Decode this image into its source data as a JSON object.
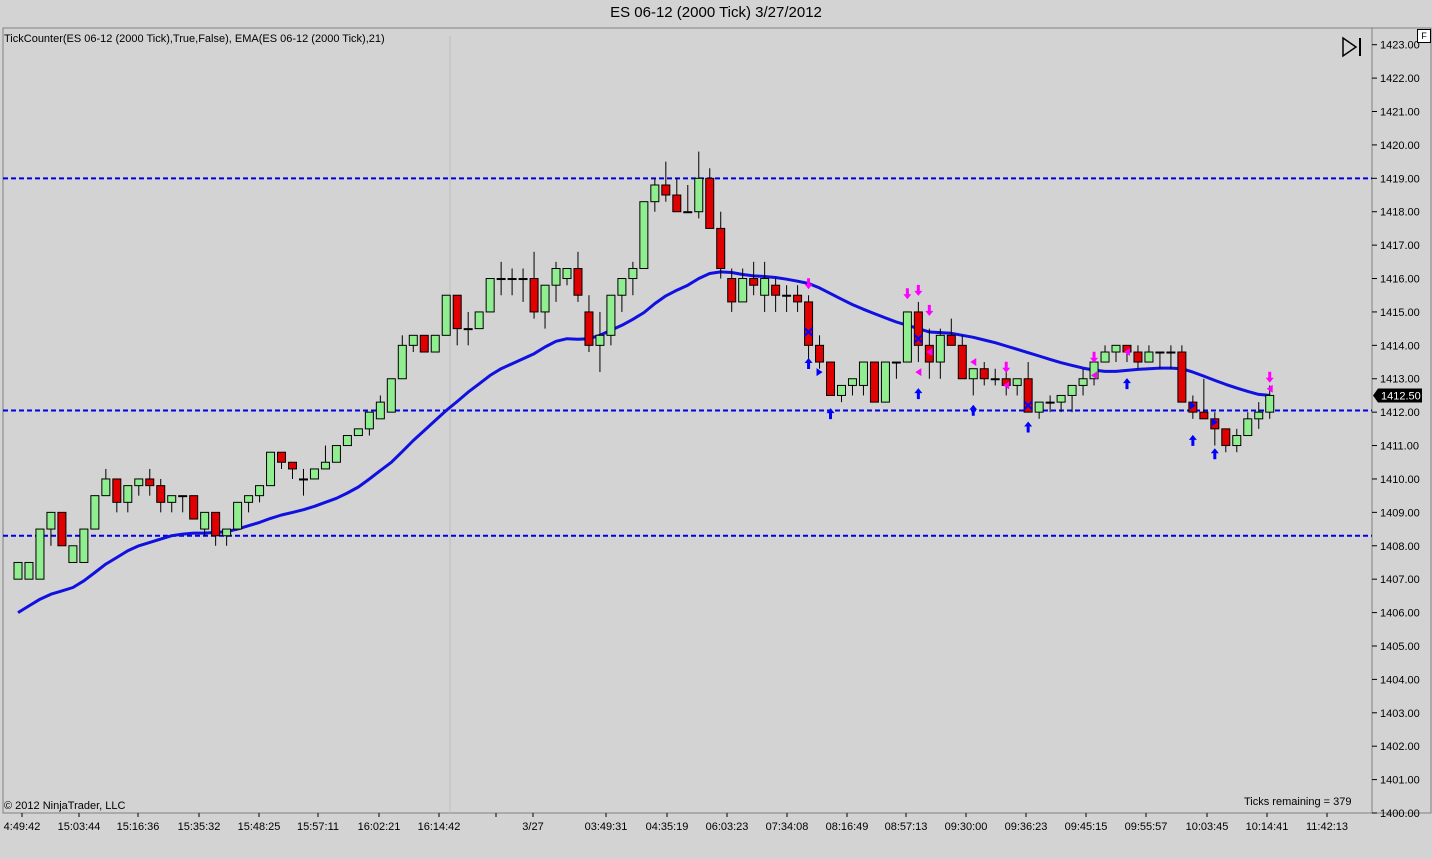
{
  "window": {
    "title": "ES 06-12 (2000 Tick)  3/27/2012"
  },
  "indicator_label": "TickCounter(ES 06-12 (2000 Tick),True,False), EMA(ES 06-12 (2000 Tick),21)",
  "copyright": "© 2012 NinjaTrader, LLC",
  "ticks_remaining": "Ticks remaining = 379",
  "panel_button": "F",
  "price_tag": "1412.50",
  "colors": {
    "up": "#90ee90",
    "down": "#e00000",
    "ema": "#1010e0",
    "hline": "#0000e0",
    "marker_buy": "#0000ff",
    "marker_sell": "#ff00ff"
  },
  "chart_data": {
    "type": "candlestick",
    "ylim": [
      1400,
      1423.5
    ],
    "y_ticks": [
      1400,
      1401,
      1402,
      1403,
      1404,
      1405,
      1406,
      1407,
      1408,
      1409,
      1410,
      1411,
      1412,
      1413,
      1414,
      1415,
      1416,
      1417,
      1418,
      1419,
      1420,
      1421,
      1422,
      1423
    ],
    "x_ticks": [
      "4:49:42",
      "15:03:44",
      "15:16:36",
      "15:35:32",
      "15:48:25",
      "15:57:11",
      "16:02:21",
      "16:14:42",
      "3/27",
      "03:49:31",
      "04:35:19",
      "06:03:23",
      "07:34:08",
      "08:16:49",
      "08:57:13",
      "09:30:00",
      "09:36:23",
      "09:45:15",
      "09:55:57",
      "10:03:45",
      "10:14:41",
      "11:42:13"
    ],
    "horizontal_lines": [
      1419.0,
      1412.05,
      1408.3
    ],
    "candles": [
      [
        1407.0,
        1407.5,
        1407.0,
        1407.5
      ],
      [
        1407.0,
        1407.5,
        1407.0,
        1407.5
      ],
      [
        1407.0,
        1408.5,
        1407.0,
        1408.5
      ],
      [
        1408.5,
        1409.0,
        1408.0,
        1409.0
      ],
      [
        1409.0,
        1409.0,
        1408.0,
        1408.0
      ],
      [
        1407.5,
        1408.0,
        1407.5,
        1408.0
      ],
      [
        1407.5,
        1408.5,
        1407.5,
        1408.5
      ],
      [
        1408.5,
        1409.5,
        1408.5,
        1409.5
      ],
      [
        1409.5,
        1410.3,
        1409.5,
        1410.0
      ],
      [
        1410.0,
        1410.0,
        1409.0,
        1409.3
      ],
      [
        1409.3,
        1409.8,
        1409.0,
        1409.8
      ],
      [
        1409.8,
        1410.0,
        1409.5,
        1410.0
      ],
      [
        1410.0,
        1410.3,
        1409.5,
        1409.8
      ],
      [
        1409.8,
        1410.0,
        1409.0,
        1409.3
      ],
      [
        1409.3,
        1409.5,
        1409.0,
        1409.5
      ],
      [
        1409.5,
        1409.5,
        1409.0,
        1409.5
      ],
      [
        1409.5,
        1409.5,
        1408.8,
        1408.8
      ],
      [
        1408.5,
        1409.0,
        1408.3,
        1409.0
      ],
      [
        1409.0,
        1409.0,
        1408.0,
        1408.3
      ],
      [
        1408.3,
        1408.5,
        1408.0,
        1408.5
      ],
      [
        1408.5,
        1409.3,
        1408.5,
        1409.3
      ],
      [
        1409.3,
        1409.5,
        1409.0,
        1409.5
      ],
      [
        1409.5,
        1409.8,
        1409.3,
        1409.8
      ],
      [
        1409.8,
        1410.8,
        1409.8,
        1410.8
      ],
      [
        1410.8,
        1410.8,
        1410.3,
        1410.5
      ],
      [
        1410.5,
        1410.5,
        1410.0,
        1410.3
      ],
      [
        1410.0,
        1410.3,
        1409.5,
        1410.0
      ],
      [
        1410.0,
        1410.3,
        1410.0,
        1410.3
      ],
      [
        1410.3,
        1411.0,
        1410.3,
        1410.5
      ],
      [
        1410.5,
        1411.0,
        1410.5,
        1411.0
      ],
      [
        1411.0,
        1411.3,
        1411.0,
        1411.3
      ],
      [
        1411.3,
        1411.5,
        1411.3,
        1411.5
      ],
      [
        1411.5,
        1412.0,
        1411.3,
        1412.0
      ],
      [
        1411.8,
        1412.5,
        1411.8,
        1412.3
      ],
      [
        1412.0,
        1413.0,
        1412.0,
        1413.0
      ],
      [
        1413.0,
        1414.3,
        1413.0,
        1414.0
      ],
      [
        1414.0,
        1414.3,
        1413.8,
        1414.3
      ],
      [
        1414.3,
        1414.3,
        1413.8,
        1413.8
      ],
      [
        1413.8,
        1414.3,
        1413.8,
        1414.3
      ],
      [
        1414.3,
        1415.5,
        1414.3,
        1415.5
      ],
      [
        1415.5,
        1415.5,
        1414.0,
        1414.5
      ],
      [
        1414.5,
        1415.0,
        1414.0,
        1414.5
      ],
      [
        1414.5,
        1415.0,
        1414.5,
        1415.0
      ],
      [
        1415.0,
        1416.0,
        1415.0,
        1416.0
      ],
      [
        1416.0,
        1416.5,
        1415.5,
        1416.0
      ],
      [
        1416.0,
        1416.3,
        1415.5,
        1416.0
      ],
      [
        1416.0,
        1416.3,
        1415.3,
        1416.0
      ],
      [
        1416.0,
        1416.8,
        1414.8,
        1415.0
      ],
      [
        1415.0,
        1415.8,
        1414.5,
        1415.8
      ],
      [
        1415.8,
        1416.5,
        1415.3,
        1416.3
      ],
      [
        1416.0,
        1416.3,
        1415.8,
        1416.3
      ],
      [
        1416.3,
        1416.8,
        1415.3,
        1415.5
      ],
      [
        1415.0,
        1415.5,
        1413.8,
        1414.0
      ],
      [
        1414.0,
        1415.0,
        1413.2,
        1414.3
      ],
      [
        1414.3,
        1415.5,
        1414.0,
        1415.5
      ],
      [
        1415.5,
        1416.0,
        1415.0,
        1416.0
      ],
      [
        1416.0,
        1416.5,
        1415.5,
        1416.3
      ],
      [
        1416.3,
        1418.3,
        1416.3,
        1418.3
      ],
      [
        1418.3,
        1419.0,
        1418.0,
        1418.8
      ],
      [
        1418.8,
        1419.5,
        1418.3,
        1418.5
      ],
      [
        1418.5,
        1419.0,
        1418.0,
        1418.0
      ],
      [
        1418.0,
        1418.8,
        1418.0,
        1418.0
      ],
      [
        1418.0,
        1419.8,
        1417.8,
        1419.0
      ],
      [
        1419.0,
        1419.3,
        1417.5,
        1417.5
      ],
      [
        1417.5,
        1418.0,
        1416.0,
        1416.3
      ],
      [
        1416.0,
        1416.3,
        1415.0,
        1415.3
      ],
      [
        1415.3,
        1416.3,
        1415.3,
        1416.0
      ],
      [
        1416.0,
        1416.5,
        1415.5,
        1415.8
      ],
      [
        1415.5,
        1416.5,
        1415.0,
        1416.0
      ],
      [
        1415.8,
        1416.0,
        1415.0,
        1415.5
      ],
      [
        1415.5,
        1415.8,
        1415.0,
        1415.5
      ],
      [
        1415.5,
        1415.8,
        1415.0,
        1415.3
      ],
      [
        1415.3,
        1415.5,
        1413.5,
        1414.0
      ],
      [
        1414.0,
        1414.3,
        1413.3,
        1413.5
      ],
      [
        1413.5,
        1413.5,
        1412.5,
        1412.5
      ],
      [
        1412.5,
        1412.8,
        1412.3,
        1412.8
      ],
      [
        1412.8,
        1413.0,
        1412.5,
        1413.0
      ],
      [
        1412.8,
        1413.5,
        1412.5,
        1413.5
      ],
      [
        1413.5,
        1413.5,
        1412.3,
        1412.3
      ],
      [
        1412.3,
        1413.5,
        1412.3,
        1413.5
      ],
      [
        1413.5,
        1413.5,
        1413.0,
        1413.5
      ],
      [
        1413.5,
        1415.0,
        1413.5,
        1415.0
      ],
      [
        1415.0,
        1415.3,
        1413.5,
        1414.0
      ],
      [
        1414.0,
        1414.5,
        1413.0,
        1413.5
      ],
      [
        1413.5,
        1414.5,
        1413.0,
        1414.3
      ],
      [
        1414.3,
        1414.8,
        1414.0,
        1414.0
      ],
      [
        1414.0,
        1414.3,
        1413.0,
        1413.0
      ],
      [
        1413.0,
        1413.3,
        1412.5,
        1413.3
      ],
      [
        1413.3,
        1413.5,
        1412.8,
        1413.0
      ],
      [
        1413.0,
        1413.3,
        1412.8,
        1413.0
      ],
      [
        1413.0,
        1413.5,
        1412.5,
        1412.8
      ],
      [
        1412.8,
        1413.0,
        1412.5,
        1413.0
      ],
      [
        1413.0,
        1413.5,
        1412.0,
        1412.0
      ],
      [
        1412.0,
        1412.3,
        1411.8,
        1412.3
      ],
      [
        1412.3,
        1412.5,
        1412.0,
        1412.3
      ],
      [
        1412.3,
        1412.5,
        1412.0,
        1412.5
      ],
      [
        1412.5,
        1412.8,
        1412.0,
        1412.8
      ],
      [
        1412.8,
        1413.3,
        1412.5,
        1413.0
      ],
      [
        1413.0,
        1413.5,
        1412.8,
        1413.5
      ],
      [
        1413.5,
        1414.0,
        1413.5,
        1413.8
      ],
      [
        1413.8,
        1414.0,
        1413.5,
        1414.0
      ],
      [
        1414.0,
        1414.0,
        1413.5,
        1413.8
      ],
      [
        1413.8,
        1414.0,
        1413.3,
        1413.5
      ],
      [
        1413.5,
        1414.0,
        1413.5,
        1413.8
      ],
      [
        1413.8,
        1413.8,
        1413.3,
        1413.8
      ],
      [
        1413.8,
        1414.0,
        1413.3,
        1413.8
      ],
      [
        1413.8,
        1414.0,
        1412.3,
        1412.3
      ],
      [
        1412.3,
        1412.5,
        1411.8,
        1412.0
      ],
      [
        1412.0,
        1413.0,
        1411.8,
        1411.8
      ],
      [
        1411.8,
        1412.0,
        1411.0,
        1411.5
      ],
      [
        1411.5,
        1411.5,
        1410.8,
        1411.0
      ],
      [
        1411.0,
        1411.5,
        1410.8,
        1411.3
      ],
      [
        1411.3,
        1412.0,
        1411.3,
        1411.8
      ],
      [
        1411.8,
        1412.3,
        1411.5,
        1412.0
      ],
      [
        1412.0,
        1412.8,
        1411.8,
        1412.5
      ]
    ],
    "ema_series": {
      "values": [
        1406.0,
        1406.2,
        1406.4,
        1406.55,
        1406.65,
        1406.75,
        1406.95,
        1407.2,
        1407.45,
        1407.65,
        1407.85,
        1408.0,
        1408.1,
        1408.2,
        1408.3,
        1408.35,
        1408.38,
        1408.38,
        1408.4,
        1408.42,
        1408.5,
        1408.6,
        1408.7,
        1408.82,
        1408.92,
        1409.0,
        1409.08,
        1409.18,
        1409.3,
        1409.42,
        1409.58,
        1409.76,
        1410.0,
        1410.25,
        1410.5,
        1410.82,
        1411.15,
        1411.45,
        1411.75,
        1412.05,
        1412.32,
        1412.6,
        1412.85,
        1413.1,
        1413.3,
        1413.45,
        1413.6,
        1413.75,
        1413.95,
        1414.12,
        1414.2,
        1414.18,
        1414.2,
        1414.3,
        1414.45,
        1414.6,
        1414.78,
        1414.98,
        1415.25,
        1415.48,
        1415.65,
        1415.8,
        1416.0,
        1416.15,
        1416.2,
        1416.18,
        1416.12,
        1416.08,
        1416.06,
        1416.03,
        1415.98,
        1415.92,
        1415.85,
        1415.72,
        1415.55,
        1415.38,
        1415.22,
        1415.08,
        1414.95,
        1414.82,
        1414.7,
        1414.6,
        1414.5,
        1414.4,
        1414.38,
        1414.36,
        1414.3,
        1414.24,
        1414.16,
        1414.08,
        1413.98,
        1413.88,
        1413.78,
        1413.68,
        1413.58,
        1413.48,
        1413.4,
        1413.32,
        1413.26,
        1413.22,
        1413.22,
        1413.25,
        1413.28,
        1413.3,
        1413.32,
        1413.32,
        1413.3,
        1413.2,
        1413.08,
        1412.95,
        1412.83,
        1412.72,
        1412.62,
        1412.53,
        1412.5
      ]
    },
    "markers": [
      {
        "bar": 72,
        "price": 1415.8,
        "dir": "down"
      },
      {
        "bar": 72,
        "price": 1413.5,
        "dir": "up"
      },
      {
        "bar": 72,
        "price": 1414.4,
        "dir": "x"
      },
      {
        "bar": 73,
        "price": 1413.2,
        "dir": "right"
      },
      {
        "bar": 74,
        "price": 1412.0,
        "dir": "up"
      },
      {
        "bar": 81,
        "price": 1415.5,
        "dir": "down"
      },
      {
        "bar": 82,
        "price": 1415.6,
        "dir": "down"
      },
      {
        "bar": 82,
        "price": 1412.6,
        "dir": "up"
      },
      {
        "bar": 82,
        "price": 1414.2,
        "dir": "x"
      },
      {
        "bar": 83,
        "price": 1415.0,
        "dir": "down"
      },
      {
        "bar": 82,
        "price": 1413.2,
        "dir": "left"
      },
      {
        "bar": 83,
        "price": 1413.8,
        "dir": "left"
      },
      {
        "bar": 87,
        "price": 1413.5,
        "dir": "left"
      },
      {
        "bar": 87,
        "price": 1412.1,
        "dir": "up"
      },
      {
        "bar": 90,
        "price": 1413.3,
        "dir": "down"
      },
      {
        "bar": 90,
        "price": 1412.8,
        "dir": "left"
      },
      {
        "bar": 92,
        "price": 1411.6,
        "dir": "up"
      },
      {
        "bar": 92,
        "price": 1412.2,
        "dir": "x"
      },
      {
        "bar": 98,
        "price": 1413.6,
        "dir": "down"
      },
      {
        "bar": 98,
        "price": 1413.1,
        "dir": "left"
      },
      {
        "bar": 101,
        "price": 1413.8,
        "dir": "left"
      },
      {
        "bar": 101,
        "price": 1412.9,
        "dir": "up"
      },
      {
        "bar": 107,
        "price": 1412.2,
        "dir": "right"
      },
      {
        "bar": 107,
        "price": 1411.2,
        "dir": "up"
      },
      {
        "bar": 109,
        "price": 1411.7,
        "dir": "right"
      },
      {
        "bar": 109,
        "price": 1410.8,
        "dir": "up"
      },
      {
        "bar": 114,
        "price": 1413.0,
        "dir": "down"
      },
      {
        "bar": 114,
        "price": 1412.7,
        "dir": "left"
      }
    ]
  }
}
